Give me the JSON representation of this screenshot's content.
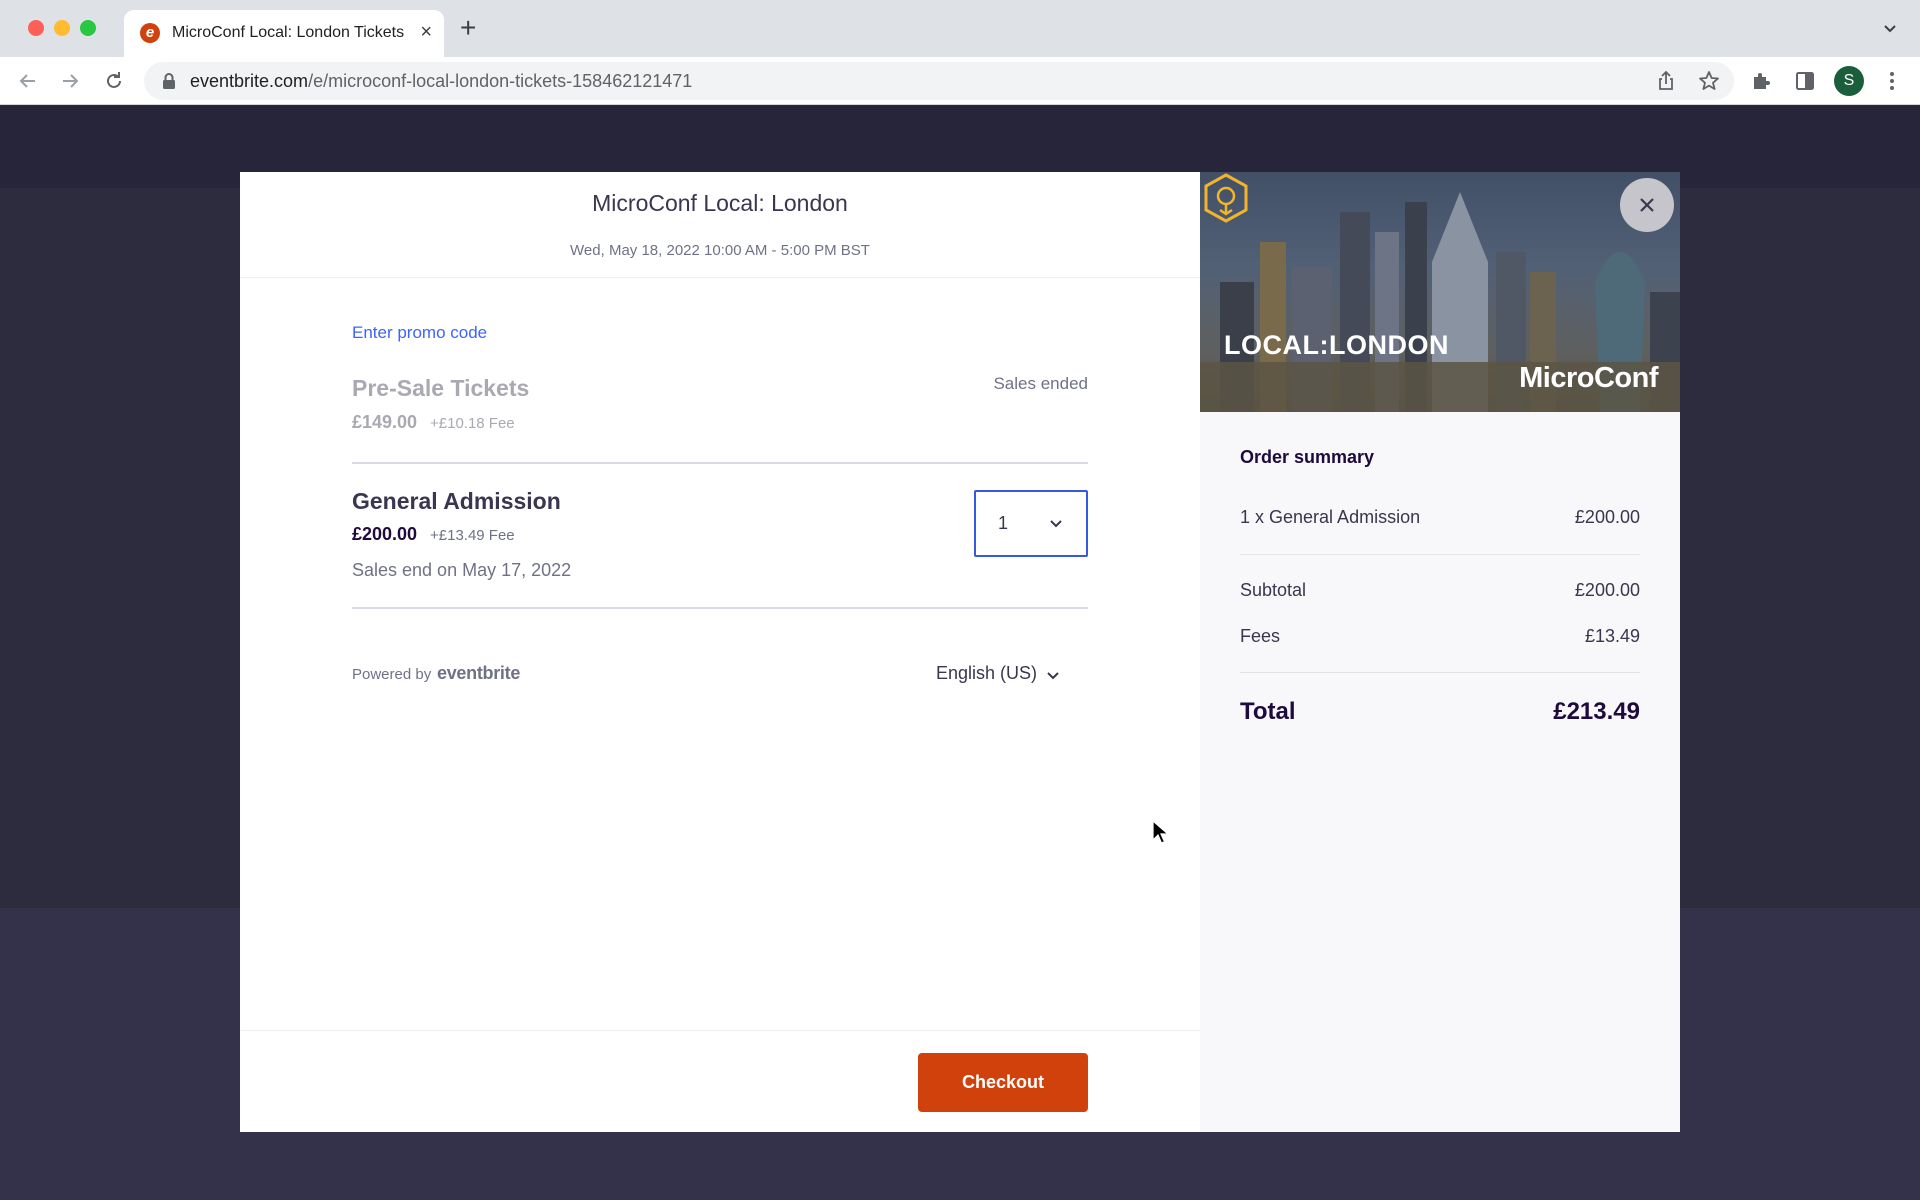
{
  "browser": {
    "tab_title": "MicroConf Local: London Tickets",
    "url_host": "eventbrite.com",
    "url_path": "/e/microconf-local-london-tickets-158462121471",
    "profile_initial": "S"
  },
  "event": {
    "title": "MicroConf Local: London",
    "datetime": "Wed, May 18, 2022 10:00 AM - 5:00 PM BST"
  },
  "tickets": {
    "promo_label": "Enter promo code",
    "presale": {
      "name": "Pre-Sale Tickets",
      "price": "£149.00",
      "fee": "+£10.18 Fee",
      "status": "Sales ended"
    },
    "general": {
      "name": "General Admission",
      "price": "£200.00",
      "fee": "+£13.49 Fee",
      "sales_end": "Sales end on May 17, 2022",
      "quantity": "1"
    }
  },
  "footer": {
    "powered_by": "Powered by",
    "brand": "eventbrite",
    "language": "English (US)",
    "checkout_label": "Checkout"
  },
  "banner": {
    "local_text": "LOCAL:LONDON",
    "brand_text": "MicroConf"
  },
  "order_summary": {
    "title": "Order summary",
    "item_label": "1 x General Admission",
    "item_amount": "£200.00",
    "subtotal_label": "Subtotal",
    "subtotal_amount": "£200.00",
    "fees_label": "Fees",
    "fees_amount": "£13.49",
    "total_label": "Total",
    "total_amount": "£213.49"
  },
  "colors": {
    "brand_orange": "#d1410c",
    "link_blue": "#3d64ff",
    "focus_blue": "#3659e3"
  }
}
